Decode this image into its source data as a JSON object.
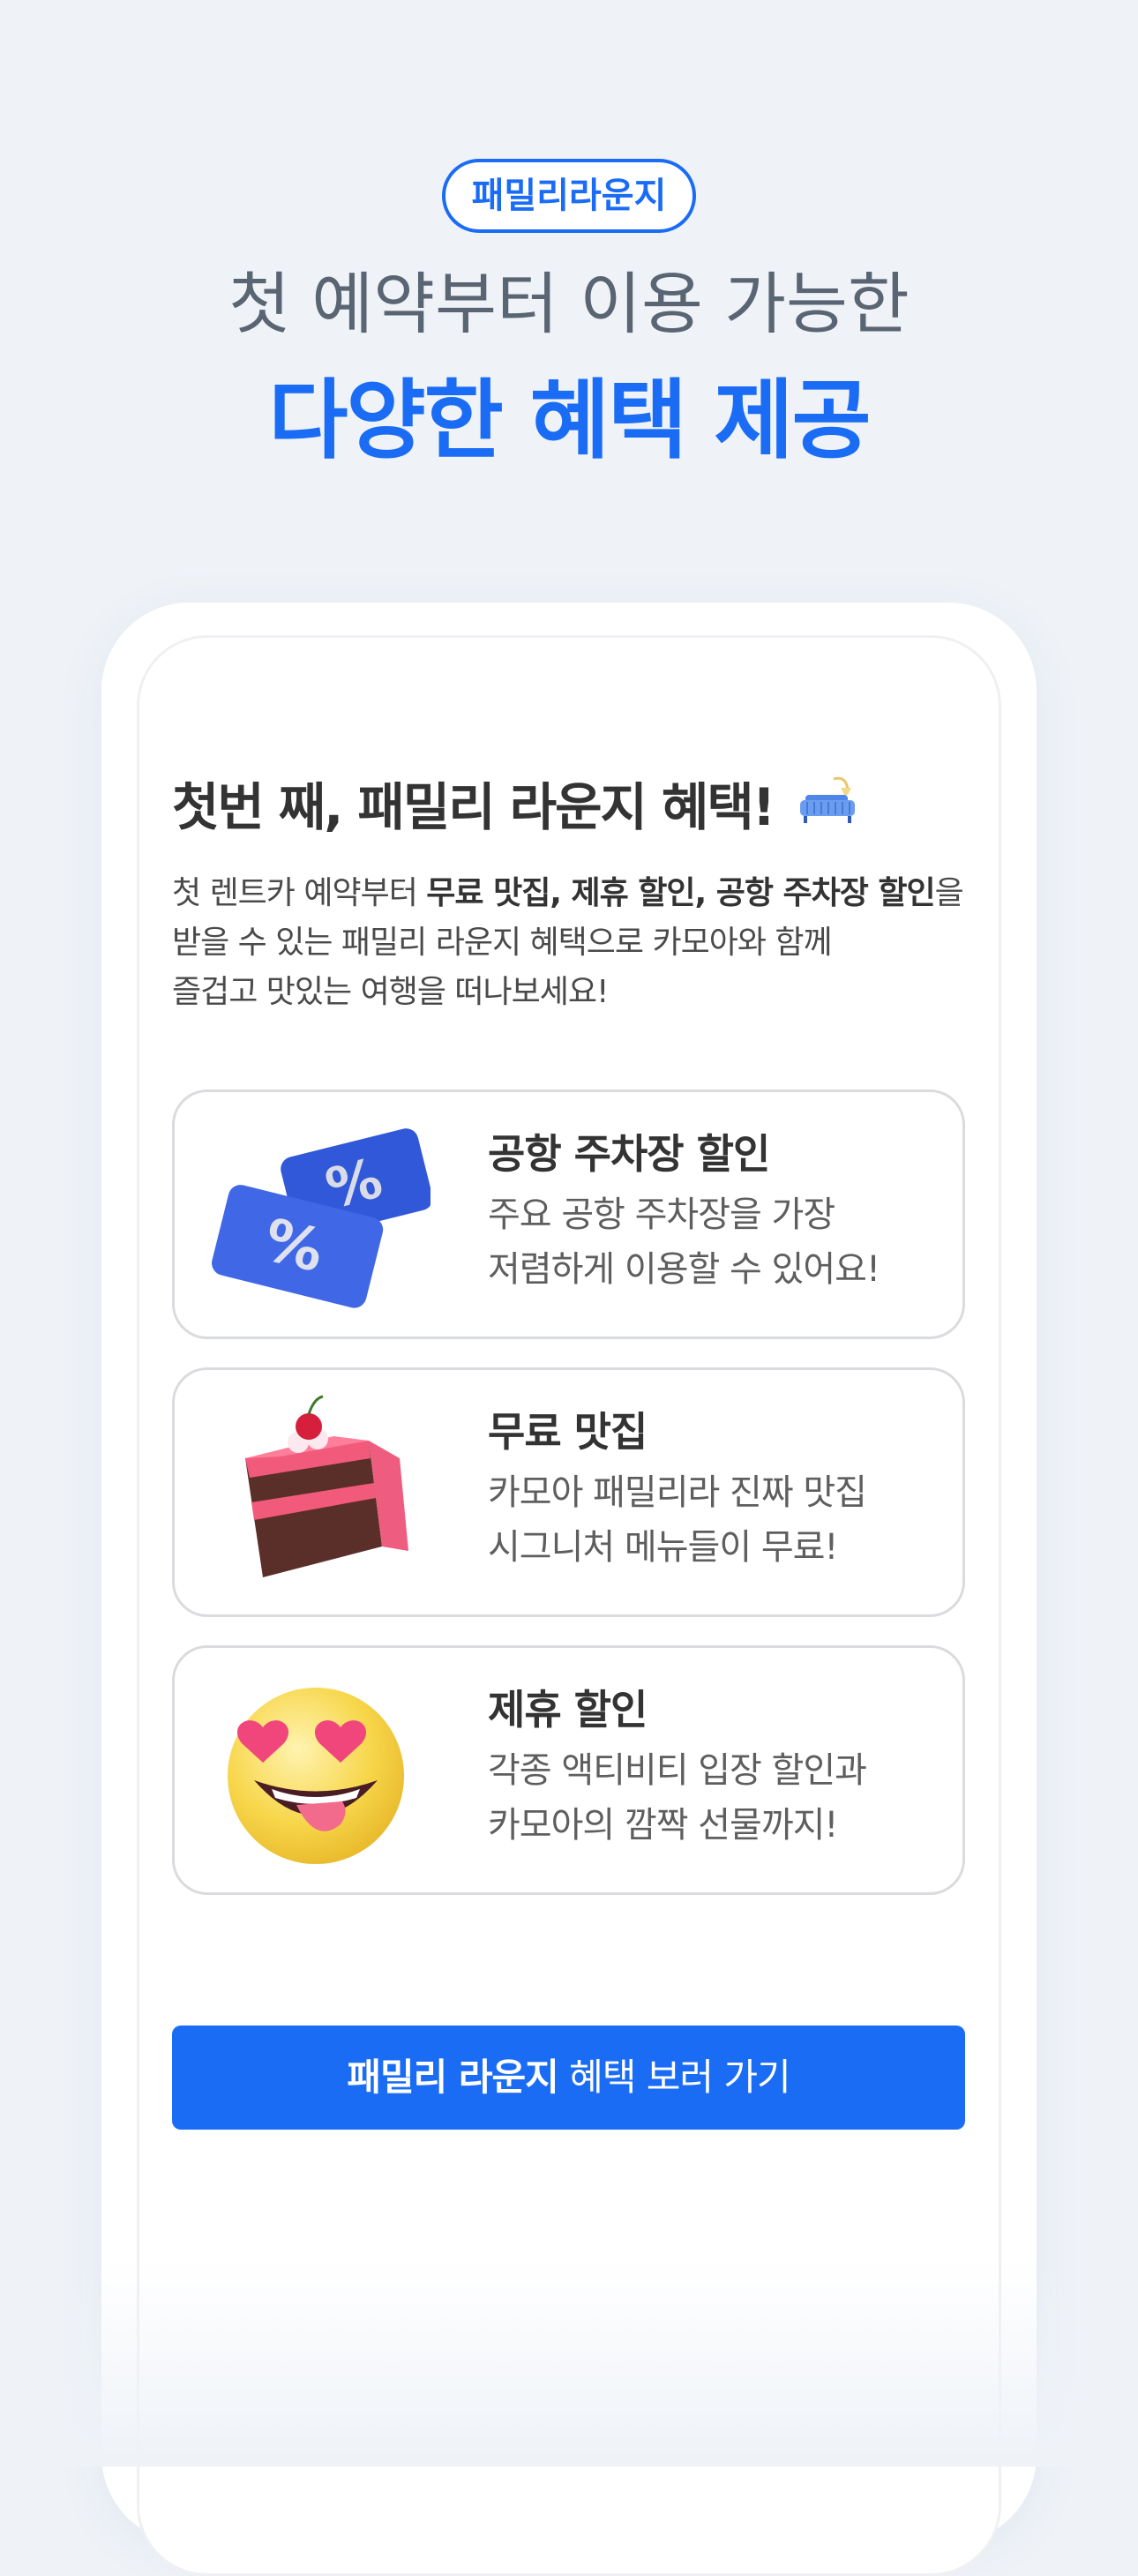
{
  "hero": {
    "badge": "패밀리라운지",
    "line1": "첫 예약부터 이용 가능한",
    "line2": "다양한 혜택 제공"
  },
  "section": {
    "title": "첫번 째, 패밀리 라운지 혜택!",
    "desc_prefix": "첫 렌트카 예약부터 ",
    "desc_bold": "무료 맛집, 제휴 할인, 공항 주차장 할인",
    "desc_suffix": "을",
    "desc_line2": "받을 수 있는 패밀리 라운지 혜택으로 카모아와 함께",
    "desc_line3": "즐겁고 맛있는 여행을 떠나보세요!"
  },
  "benefits": [
    {
      "icon": "discount-tickets-icon",
      "title": "공항 주차장 할인",
      "line1": "주요 공항 주차장을 가장",
      "line2": "저렴하게 이용할 수 있어요!"
    },
    {
      "icon": "cake-icon",
      "title": "무료 맛집",
      "line1": "카모아 패밀리라 진짜 맛집",
      "line2": "시그니처 메뉴들이 무료!"
    },
    {
      "icon": "heart-eyes-emoji-icon",
      "title": "제휴 할인",
      "line1": "각종 액티비티 입장 할인과",
      "line2": "카모아의 깜짝 선물까지!"
    }
  ],
  "cta": {
    "bold": "패밀리 라운지",
    "rest": " 혜택 보러 가기"
  },
  "colors": {
    "accent": "#1a6cf5",
    "background": "#eff3f8",
    "card_border": "#d9dbde"
  }
}
